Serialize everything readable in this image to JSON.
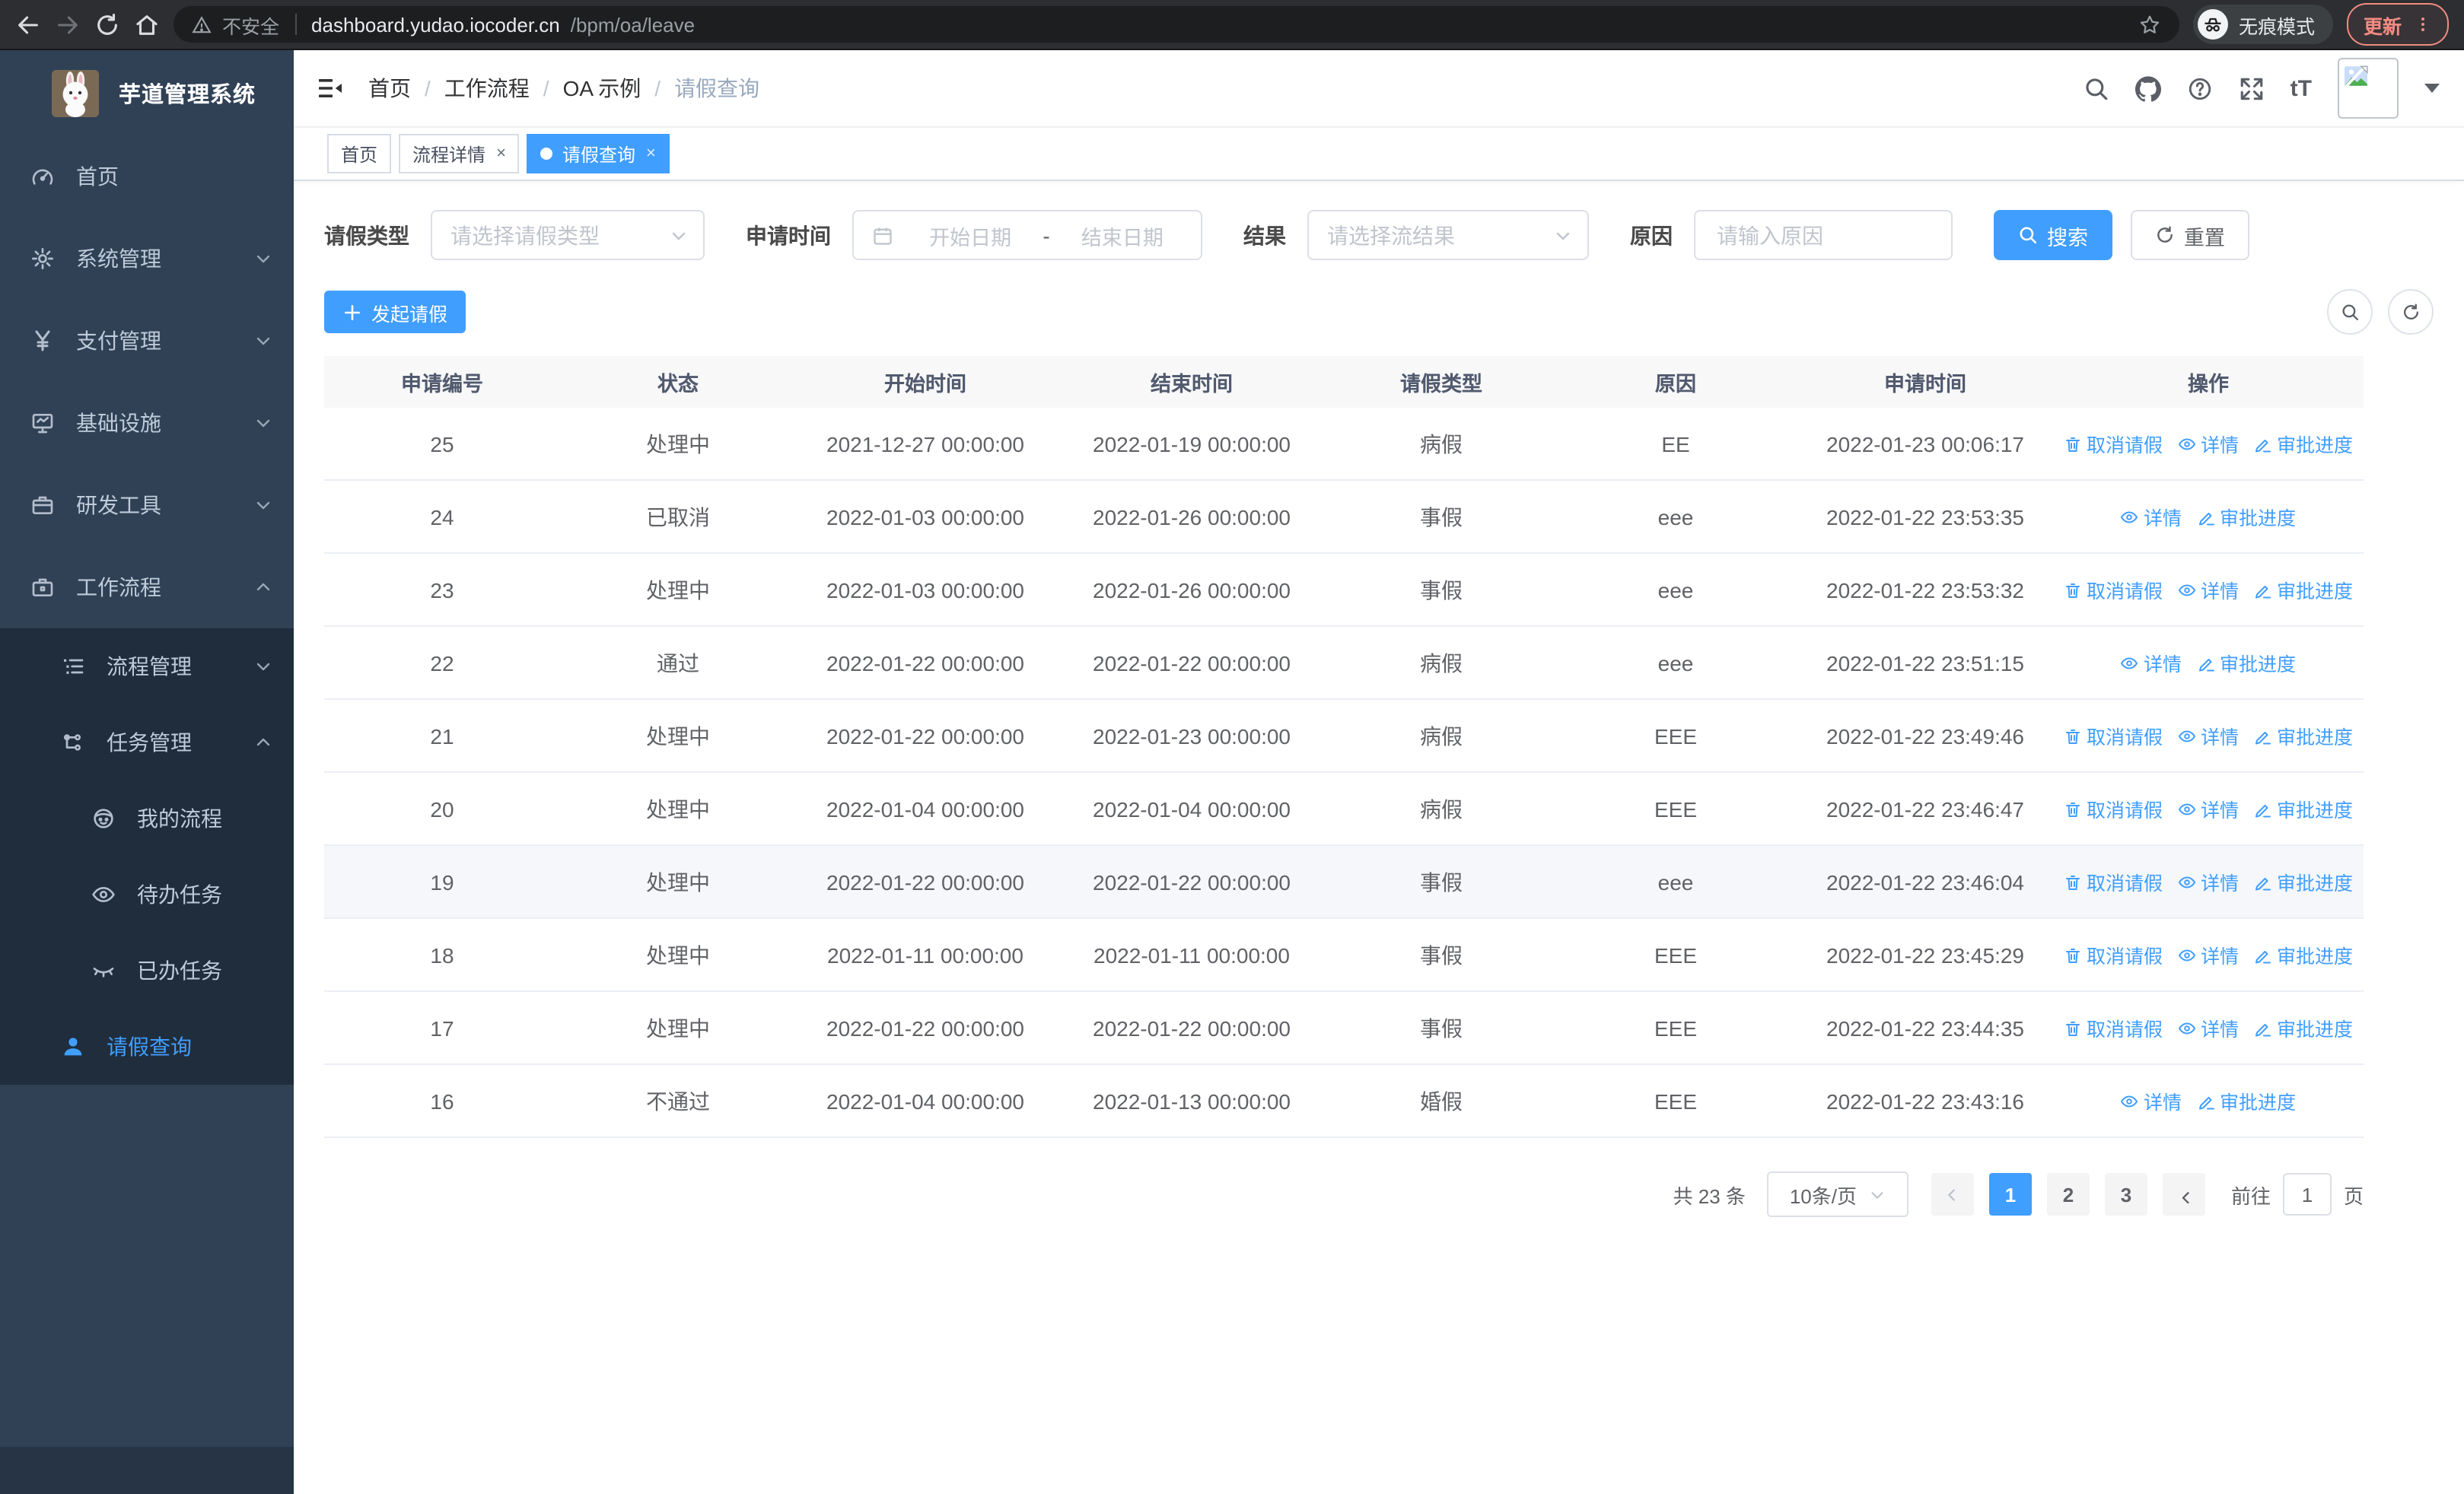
{
  "colors": {
    "accent": "#409eff",
    "sidebar_bg": "#304156",
    "submenu_bg": "#1f2d3d",
    "table_header_bg": "#f8f8f9"
  },
  "browser": {
    "security_label": "不安全",
    "url_host": "dashboard.yudao.iocoder.cn",
    "url_path": "/bpm/oa/leave",
    "incognito_label": "无痕模式",
    "update_label": "更新"
  },
  "sidebar": {
    "title": "芋道管理系统",
    "items": {
      "home": "首页",
      "system": "系统管理",
      "payment": "支付管理",
      "infra": "基础设施",
      "devtools": "研发工具",
      "workflow": "工作流程",
      "process_mgmt": "流程管理",
      "task_mgmt": "任务管理",
      "my_process": "我的流程",
      "todo_tasks": "待办任务",
      "done_tasks": "已办任务",
      "leave_query": "请假查询"
    }
  },
  "navbar": {
    "breadcrumb": [
      "首页",
      "工作流程",
      "OA 示例",
      "请假查询"
    ],
    "textsize_label": "tT"
  },
  "tabs": [
    {
      "label": "首页",
      "closable": false,
      "active": false
    },
    {
      "label": "流程详情",
      "closable": true,
      "active": false
    },
    {
      "label": "请假查询",
      "closable": true,
      "active": true
    }
  ],
  "filters": {
    "leave_type_label": "请假类型",
    "leave_type_placeholder": "请选择请假类型",
    "apply_time_label": "申请时间",
    "start_date_placeholder": "开始日期",
    "date_separator": "-",
    "end_date_placeholder": "结束日期",
    "result_label": "结果",
    "result_placeholder": "请选择流结果",
    "reason_label": "原因",
    "reason_placeholder": "请输入原因",
    "search_label": "搜索",
    "reset_label": "重置"
  },
  "toolbar": {
    "create_label": "发起请假"
  },
  "table": {
    "columns": [
      "申请编号",
      "状态",
      "开始时间",
      "结束时间",
      "请假类型",
      "原因",
      "申请时间",
      "操作"
    ],
    "action_labels": {
      "cancel": "取消请假",
      "detail": "详情",
      "progress": "审批进度"
    },
    "rows": [
      {
        "id": "25",
        "status": "处理中",
        "start": "2021-12-27 00:00:00",
        "end": "2022-01-19 00:00:00",
        "type": "病假",
        "reason": "EE",
        "applied": "2022-01-23 00:06:17",
        "actions": [
          "cancel",
          "detail",
          "progress"
        ],
        "hover": false
      },
      {
        "id": "24",
        "status": "已取消",
        "start": "2022-01-03 00:00:00",
        "end": "2022-01-26 00:00:00",
        "type": "事假",
        "reason": "eee",
        "applied": "2022-01-22 23:53:35",
        "actions": [
          "detail",
          "progress"
        ],
        "hover": false
      },
      {
        "id": "23",
        "status": "处理中",
        "start": "2022-01-03 00:00:00",
        "end": "2022-01-26 00:00:00",
        "type": "事假",
        "reason": "eee",
        "applied": "2022-01-22 23:53:32",
        "actions": [
          "cancel",
          "detail",
          "progress"
        ],
        "hover": false
      },
      {
        "id": "22",
        "status": "通过",
        "start": "2022-01-22 00:00:00",
        "end": "2022-01-22 00:00:00",
        "type": "病假",
        "reason": "eee",
        "applied": "2022-01-22 23:51:15",
        "actions": [
          "detail",
          "progress"
        ],
        "hover": false
      },
      {
        "id": "21",
        "status": "处理中",
        "start": "2022-01-22 00:00:00",
        "end": "2022-01-23 00:00:00",
        "type": "病假",
        "reason": "EEE",
        "applied": "2022-01-22 23:49:46",
        "actions": [
          "cancel",
          "detail",
          "progress"
        ],
        "hover": false
      },
      {
        "id": "20",
        "status": "处理中",
        "start": "2022-01-04 00:00:00",
        "end": "2022-01-04 00:00:00",
        "type": "病假",
        "reason": "EEE",
        "applied": "2022-01-22 23:46:47",
        "actions": [
          "cancel",
          "detail",
          "progress"
        ],
        "hover": false
      },
      {
        "id": "19",
        "status": "处理中",
        "start": "2022-01-22 00:00:00",
        "end": "2022-01-22 00:00:00",
        "type": "事假",
        "reason": "eee",
        "applied": "2022-01-22 23:46:04",
        "actions": [
          "cancel",
          "detail",
          "progress"
        ],
        "hover": true
      },
      {
        "id": "18",
        "status": "处理中",
        "start": "2022-01-11 00:00:00",
        "end": "2022-01-11 00:00:00",
        "type": "事假",
        "reason": "EEE",
        "applied": "2022-01-22 23:45:29",
        "actions": [
          "cancel",
          "detail",
          "progress"
        ],
        "hover": false
      },
      {
        "id": "17",
        "status": "处理中",
        "start": "2022-01-22 00:00:00",
        "end": "2022-01-22 00:00:00",
        "type": "事假",
        "reason": "EEE",
        "applied": "2022-01-22 23:44:35",
        "actions": [
          "cancel",
          "detail",
          "progress"
        ],
        "hover": false
      },
      {
        "id": "16",
        "status": "不通过",
        "start": "2022-01-04 00:00:00",
        "end": "2022-01-13 00:00:00",
        "type": "婚假",
        "reason": "EEE",
        "applied": "2022-01-22 23:43:16",
        "actions": [
          "detail",
          "progress"
        ],
        "hover": false
      }
    ]
  },
  "pagination": {
    "total_label": "共 23 条",
    "size_label": "10条/页",
    "pages": [
      "1",
      "2",
      "3"
    ],
    "active_page": "1",
    "goto_label": "前往",
    "goto_value": "1",
    "unit_label": "页"
  }
}
